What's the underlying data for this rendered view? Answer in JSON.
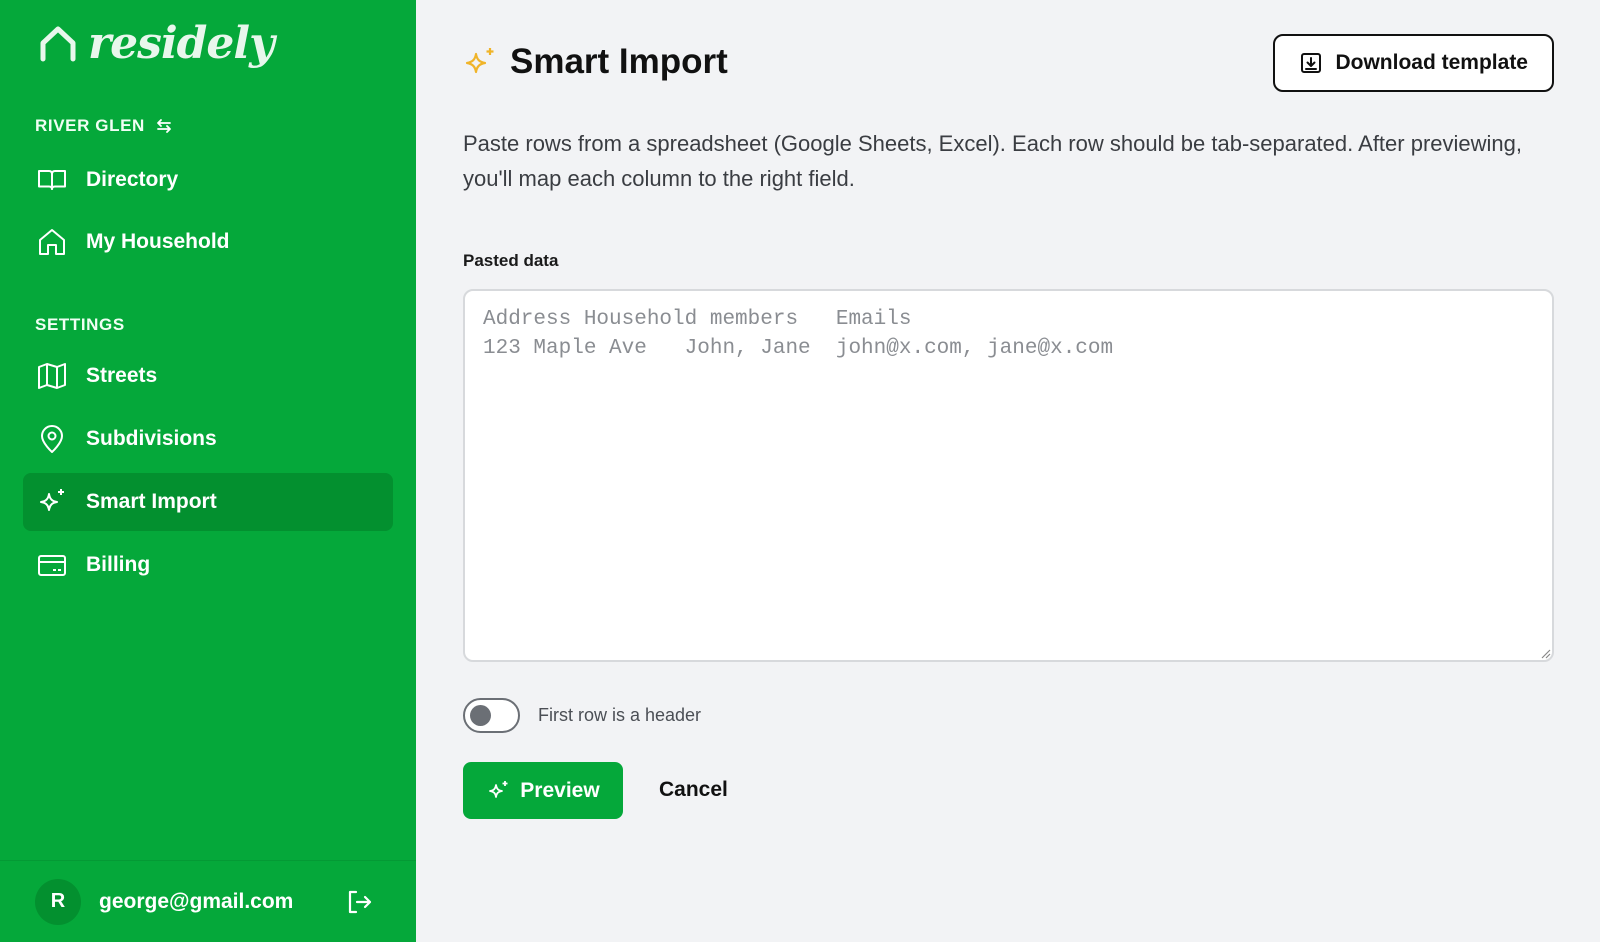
{
  "brand": {
    "name": "residely",
    "logo_icon": "house-arch-icon"
  },
  "sidebar": {
    "community": {
      "label": "RIVER GLEN",
      "icon": "switch-arrows-icon"
    },
    "main_items": [
      {
        "label": "Directory",
        "icon": "book-icon"
      },
      {
        "label": "My Household",
        "icon": "home-icon"
      }
    ],
    "settings_label": "SETTINGS",
    "settings_items": [
      {
        "label": "Streets",
        "icon": "map-icon"
      },
      {
        "label": "Subdivisions",
        "icon": "map-pin-icon"
      },
      {
        "label": "Smart Import",
        "icon": "sparkles-icon",
        "active": true
      },
      {
        "label": "Billing",
        "icon": "credit-card-icon"
      }
    ],
    "user": {
      "avatar_initial": "R",
      "email": "george@gmail.com",
      "logout_icon": "logout-icon"
    }
  },
  "main": {
    "title": "Smart Import",
    "title_icon": "sparkles-icon",
    "download_label": "Download template",
    "description": "Paste rows from a spreadsheet (Google Sheets, Excel). Each row should be tab-separated. After previewing, you'll map each column to the right field.",
    "field_label": "Pasted data",
    "textarea_placeholder": "Address Household members   Emails\n123 Maple Ave   John, Jane  john@x.com, jane@x.com",
    "toggle_label": "First row is a header",
    "toggle_on": false,
    "preview_label": "Preview",
    "cancel_label": "Cancel"
  },
  "colors": {
    "brand_green": "#05a83a",
    "active_green": "#03902f",
    "accent_gold": "#f0b429"
  }
}
